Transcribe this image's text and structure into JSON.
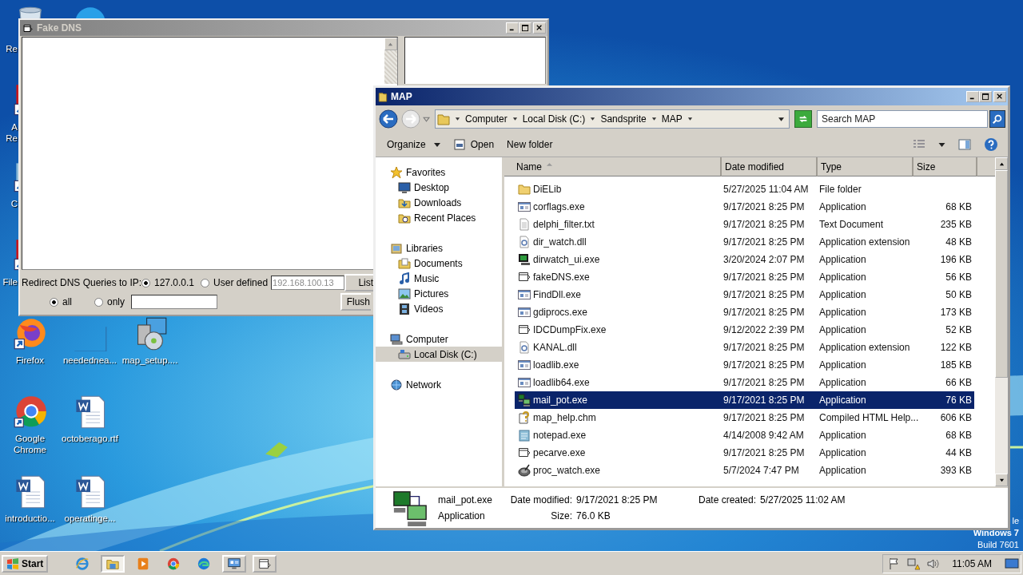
{
  "desktop_icons": [
    {
      "kind": "recycle-bin",
      "label": "Re",
      "partly_hidden": true
    },
    {
      "kind": "blue-app",
      "partly_hidden": true
    },
    {
      "kind": "red-shortcut",
      "label": "A Re",
      "partly_hidden": true
    },
    {
      "kind": "shortcut",
      "label": "C",
      "partly_hidden": true
    },
    {
      "kind": "red-shortcut",
      "label": "File",
      "partly_hidden": true
    },
    {
      "kind": "firefox",
      "label": "Firefox",
      "partly_hidden": false
    },
    {
      "kind": "chrome",
      "label": "Google Chrome",
      "partly_hidden": false
    },
    {
      "kind": "word",
      "label": "introductio...",
      "partly_hidden": false
    },
    {
      "kind": "blank",
      "label": "neededneа...",
      "partly_hidden": false
    },
    {
      "kind": "word",
      "label": "octoberago.rtf",
      "partly_hidden": false
    },
    {
      "kind": "word",
      "label": "operatinge...",
      "partly_hidden": false
    },
    {
      "kind": "installer",
      "label": "map_setup....",
      "partly_hidden": false
    }
  ],
  "os_notice": [
    "le",
    "Windows 7",
    "Build 7601"
  ],
  "fake_dns": {
    "title": "Fake DNS",
    "redirect_label": "Redirect DNS Queries to IP:",
    "ip_options": [
      {
        "label": "127.0.0.1",
        "selected": true
      },
      {
        "label": "User defined",
        "selected": false
      }
    ],
    "ip_field": {
      "value": "192.168.100.13",
      "disabled": true
    },
    "filter_options": [
      {
        "label": "all",
        "selected": true
      },
      {
        "label": "only",
        "selected": false
      }
    ],
    "buttons": [
      "List",
      "Flush"
    ]
  },
  "explorer": {
    "title": "MAP",
    "breadcrumb": [
      "Computer",
      "Local Disk (C:)",
      "Sandsprite",
      "MAP"
    ],
    "search": {
      "placeholder": "Search MAP"
    },
    "toolbar": [
      {
        "label": "Organize",
        "kind": "menu"
      },
      {
        "label": "Open",
        "kind": "open"
      },
      {
        "label": "New folder",
        "kind": "plain"
      }
    ],
    "nav": [
      {
        "label": "Favorites",
        "kind": "star",
        "selected": false,
        "children": [
          {
            "label": "Desktop",
            "kind": "desktop",
            "selected": false
          },
          {
            "label": "Downloads",
            "kind": "downloads",
            "selected": false
          },
          {
            "label": "Recent Places",
            "kind": "recent",
            "selected": false
          }
        ]
      },
      {
        "label": "Libraries",
        "kind": "library",
        "selected": false,
        "children": [
          {
            "label": "Documents",
            "kind": "documents",
            "selected": false
          },
          {
            "label": "Music",
            "kind": "music",
            "selected": false
          },
          {
            "label": "Pictures",
            "kind": "pictures",
            "selected": false
          },
          {
            "label": "Videos",
            "kind": "videos",
            "selected": false
          }
        ]
      },
      {
        "label": "Computer",
        "kind": "computer",
        "selected": false,
        "children": [
          {
            "label": "Local Disk (C:)",
            "kind": "disk",
            "selected": true
          }
        ]
      },
      {
        "label": "Network",
        "kind": "network",
        "selected": false
      }
    ],
    "columns": [
      "Name",
      "Date modified",
      "Type",
      "Size"
    ],
    "rows": [
      {
        "name": "DiELib",
        "date": "5/27/2025 11:04 AM",
        "type": "File folder",
        "kind": "folder",
        "selected": false
      },
      {
        "name": "corflags.exe",
        "date": "9/17/2021 8:25 PM",
        "type": "Application",
        "size": "68 KB",
        "kind": "exe",
        "selected": false
      },
      {
        "name": "delphi_filter.txt",
        "date": "9/17/2021 8:25 PM",
        "type": "Text Document",
        "size": "235 KB",
        "kind": "txt",
        "selected": false
      },
      {
        "name": "dir_watch.dll",
        "date": "9/17/2021 8:25 PM",
        "type": "Application extension",
        "size": "48 KB",
        "kind": "dll",
        "selected": false
      },
      {
        "name": "dirwatch_ui.exe",
        "date": "3/20/2024 2:07 PM",
        "type": "Application",
        "size": "196 KB",
        "kind": "monitor",
        "selected": false
      },
      {
        "name": "fakeDNS.exe",
        "date": "9/17/2021 8:25 PM",
        "type": "Application",
        "size": "56 KB",
        "kind": "frame",
        "selected": false
      },
      {
        "name": "FindDll.exe",
        "date": "9/17/2021 8:25 PM",
        "type": "Application",
        "size": "50 KB",
        "kind": "exe",
        "selected": false
      },
      {
        "name": "gdiprocs.exe",
        "date": "9/17/2021 8:25 PM",
        "type": "Application",
        "size": "173 KB",
        "kind": "exe",
        "selected": false
      },
      {
        "name": "IDCDumpFix.exe",
        "date": "9/12/2022 2:39 PM",
        "type": "Application",
        "size": "52 KB",
        "kind": "frame",
        "selected": false
      },
      {
        "name": "KANAL.dll",
        "date": "9/17/2021 8:25 PM",
        "type": "Application extension",
        "size": "122 KB",
        "kind": "dll",
        "selected": false
      },
      {
        "name": "loadlib.exe",
        "date": "9/17/2021 8:25 PM",
        "type": "Application",
        "size": "185 KB",
        "kind": "exe",
        "selected": false
      },
      {
        "name": "loadlib64.exe",
        "date": "9/17/2021 8:25 PM",
        "type": "Application",
        "size": "66 KB",
        "kind": "exe",
        "selected": false
      },
      {
        "name": "mail_pot.exe",
        "date": "9/17/2021 8:25 PM",
        "type": "Application",
        "size": "76 KB",
        "kind": "network",
        "selected": true
      },
      {
        "name": "map_help.chm",
        "date": "9/17/2021 8:25 PM",
        "type": "Compiled HTML Help...",
        "size": "606 KB",
        "kind": "chm",
        "selected": false
      },
      {
        "name": "notepad.exe",
        "date": "4/14/2008 9:42 AM",
        "type": "Application",
        "size": "68 KB",
        "kind": "notepad",
        "selected": false
      },
      {
        "name": "pecarve.exe",
        "date": "9/17/2021 8:25 PM",
        "type": "Application",
        "size": "44 KB",
        "kind": "frame",
        "selected": false
      },
      {
        "name": "proc_watch.exe",
        "date": "5/7/2024 7:47 PM",
        "type": "Application",
        "size": "393 KB",
        "kind": "disc",
        "selected": false
      }
    ],
    "details": {
      "name": "mail_pot.exe",
      "type": "Application",
      "kind": "network",
      "properties": [
        {
          "label": "Date modified:",
          "value": "9/17/2021 8:25 PM"
        },
        {
          "label": "Size:",
          "value": "76.0 KB"
        },
        {
          "label": "Date created:",
          "value": "5/27/2025 11:02 AM"
        }
      ]
    }
  },
  "taskbar": {
    "start": "Start",
    "items": [
      {
        "kind": "ie",
        "selected": false,
        "running": false
      },
      {
        "kind": "explorer",
        "selected": true,
        "running": true
      },
      {
        "kind": "media",
        "selected": false,
        "running": false
      },
      {
        "kind": "chrome",
        "selected": false,
        "running": false
      },
      {
        "kind": "edge",
        "selected": false,
        "running": false
      },
      {
        "kind": "remote",
        "selected": false,
        "running": true
      },
      {
        "kind": "frame",
        "selected": false,
        "running": true
      }
    ],
    "clock": "11:05 AM"
  }
}
